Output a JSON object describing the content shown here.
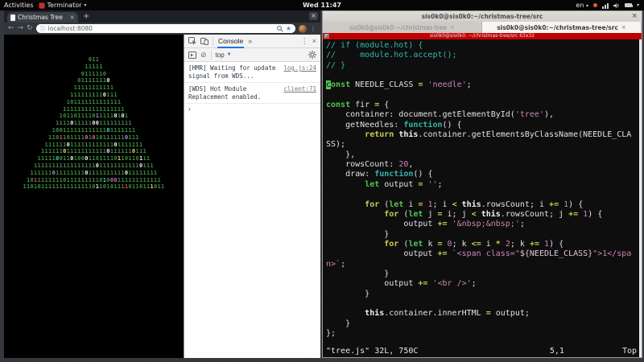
{
  "topbar": {
    "activities": "Activities",
    "app": "Terminator",
    "app_caret": "▾",
    "clock": "Wed 11:47",
    "lang": "en",
    "lang_caret": "▾",
    "system_caret": "▾"
  },
  "browser": {
    "tab_title": "Christmas Tree",
    "tab_close": "×",
    "new_tab": "+",
    "window_close": "×",
    "back": "←",
    "forward": "→",
    "reload": "↻",
    "url_info": "ⓘ",
    "url": "localhost:8080",
    "star": "★",
    "menu": "⋮"
  },
  "devtools": {
    "tab": "Console",
    "more_tabs": "»",
    "menu": "⋮",
    "close": "×",
    "clear_icon": "⊘",
    "frame": "top",
    "frame_caret": "▼",
    "prompt": "›",
    "messages": [
      {
        "text": "[HMR] Waiting for update signal from WDS...",
        "link": "log.js:24"
      },
      {
        "text": "[WDS] Hot Module Replacement enabled.",
        "link": "client:71"
      }
    ]
  },
  "tree": {
    "colors": {
      "g": "#3e8e3e",
      "w": "#e9e9e9",
      "p": "#a98ce0",
      "m": "#d063b6",
      "c": "#43cdc5",
      "r": "#d8524d",
      "y": "#d8d855"
    },
    "rows": [
      {
        "t": "011",
        "m": {}
      },
      {
        "t": "11111",
        "m": {}
      },
      {
        "t": "0111110",
        "m": {}
      },
      {
        "t": "011111110",
        "m": {
          "8": "w"
        }
      },
      {
        "t": "11111111111",
        "m": {}
      },
      {
        "t": "1111111110111",
        "m": {
          "9": "w"
        }
      },
      {
        "t": "101111111111111",
        "m": {}
      },
      {
        "t": "11111111111111111",
        "m": {}
      },
      {
        "t": "1011011110111110101",
        "m": {
          "10": "p",
          "15": "w",
          "17": "w"
        }
      },
      {
        "t": "111101111100111111111",
        "m": {
          "4": "w",
          "10": "w",
          "11": "w"
        }
      },
      {
        "t": "10011111111111101111111",
        "m": {
          "15": "c"
        }
      },
      {
        "t": "1101101111010101111110111",
        "m": {
          "3": "r",
          "10": "m",
          "12": "m",
          "21": "p"
        }
      },
      {
        "t": "111111011111111111101111111",
        "m": {
          "6": "w",
          "19": "w"
        }
      },
      {
        "t": "11111101111111111101111110111",
        "m": {
          "6": "y",
          "18": "w",
          "25": "y"
        }
      },
      {
        "t": "1111100110100011011110110110111",
        "m": {
          "5": "c",
          "9": "w",
          "13": "w",
          "22": "y",
          "28": "w"
        }
      },
      {
        "t": "111111111111111110111111111110111",
        "m": {
          "17": "w",
          "29": "w"
        }
      },
      {
        "t": "11111101111111101111111111011111111",
        "m": {
          "6": "p",
          "15": "w",
          "26": "w"
        }
      },
      {
        "t": "1011111111011111111101000111111111111",
        "m": {
          "2": "r",
          "21": "c",
          "23": "m",
          "24": "m"
        }
      },
      {
        "t": "110101111111111111101101011110110111011",
        "m": {
          "20": "w",
          "28": "r",
          "35": "y"
        }
      }
    ]
  },
  "terminal": {
    "window_title": "sis0k0@sis0k0:~/christmas-tree/src",
    "window_close": "×",
    "tabs": [
      {
        "label": "sis0k0@sis0k0:~/christmas-tree",
        "close": "×",
        "active": false
      },
      {
        "label": "sis0k0@sis0k0:~/christmas-tree/src",
        "close": "×",
        "active": true
      }
    ],
    "red_title": "sis0k0@sis0k0: ~/christmas-tree/src 63x32",
    "status": {
      "file": "\"tree.js\" 32L, 750C",
      "pos": "5,1",
      "scroll": "Top"
    },
    "code": [
      [
        [
          "// if (module.hot) {",
          "c"
        ]
      ],
      [
        [
          "//     module.hot.accept();",
          "c"
        ]
      ],
      [
        [
          "// }",
          "c"
        ]
      ],
      [],
      [
        [
          "c",
          "x"
        ],
        [
          "onst",
          "t"
        ],
        [
          " NEEDLE_CLASS ",
          "p"
        ],
        [
          "=",
          "o"
        ],
        [
          " ",
          "p"
        ],
        [
          "'needle'",
          "s"
        ],
        [
          ";",
          "p"
        ]
      ],
      [],
      [
        [
          "const",
          "t"
        ],
        [
          " fir ",
          "p"
        ],
        [
          "=",
          "o"
        ],
        [
          " {",
          "p"
        ]
      ],
      [
        [
          "    container: document.getElementById(",
          "p"
        ],
        [
          "'tree'",
          "s"
        ],
        [
          "),",
          "p"
        ]
      ],
      [
        [
          "    getNeedles: ",
          "p"
        ],
        [
          "function",
          "i"
        ],
        [
          "() {",
          "p"
        ]
      ],
      [
        [
          "        ",
          "p"
        ],
        [
          "return",
          "k"
        ],
        [
          " ",
          "p"
        ],
        [
          "this",
          "b"
        ],
        [
          ".container.getElementsByClassName(NEEDLE_CLA",
          "p"
        ]
      ],
      [
        [
          "SS);",
          "p"
        ]
      ],
      [
        [
          "    },",
          "p"
        ]
      ],
      [
        [
          "    rowsCount: ",
          "p"
        ],
        [
          "20",
          "n"
        ],
        [
          ",",
          "p"
        ]
      ],
      [
        [
          "    draw: ",
          "p"
        ],
        [
          "function",
          "i"
        ],
        [
          "() {",
          "p"
        ]
      ],
      [
        [
          "        ",
          "p"
        ],
        [
          "let",
          "t"
        ],
        [
          " output ",
          "p"
        ],
        [
          "=",
          "o"
        ],
        [
          " ",
          "p"
        ],
        [
          "''",
          "s"
        ],
        [
          ";",
          "p"
        ]
      ],
      [],
      [
        [
          "        ",
          "p"
        ],
        [
          "for",
          "k"
        ],
        [
          " (",
          "p"
        ],
        [
          "let",
          "t"
        ],
        [
          " i ",
          "p"
        ],
        [
          "=",
          "o"
        ],
        [
          " ",
          "p"
        ],
        [
          "1",
          "n"
        ],
        [
          "; i ",
          "p"
        ],
        [
          "<",
          "o"
        ],
        [
          " ",
          "p"
        ],
        [
          "this",
          "b"
        ],
        [
          ".rowsCount; i ",
          "p"
        ],
        [
          "+=",
          "o"
        ],
        [
          " ",
          "p"
        ],
        [
          "1",
          "n"
        ],
        [
          ") {",
          "p"
        ]
      ],
      [
        [
          "            ",
          "p"
        ],
        [
          "for",
          "k"
        ],
        [
          " (",
          "p"
        ],
        [
          "let",
          "t"
        ],
        [
          " j ",
          "p"
        ],
        [
          "=",
          "o"
        ],
        [
          " i; j ",
          "p"
        ],
        [
          "<",
          "o"
        ],
        [
          " ",
          "p"
        ],
        [
          "this",
          "b"
        ],
        [
          ".rowsCount; j ",
          "p"
        ],
        [
          "+=",
          "o"
        ],
        [
          " ",
          "p"
        ],
        [
          "1",
          "n"
        ],
        [
          ") {",
          "p"
        ]
      ],
      [
        [
          "                output ",
          "p"
        ],
        [
          "+=",
          "o"
        ],
        [
          " ",
          "p"
        ],
        [
          "'&nbsp;&nbsp;'",
          "s"
        ],
        [
          ";",
          "p"
        ]
      ],
      [
        [
          "            }",
          "p"
        ]
      ],
      [
        [
          "            ",
          "p"
        ],
        [
          "for",
          "k"
        ],
        [
          " (",
          "p"
        ],
        [
          "let",
          "t"
        ],
        [
          " k ",
          "p"
        ],
        [
          "=",
          "o"
        ],
        [
          " ",
          "p"
        ],
        [
          "0",
          "n"
        ],
        [
          "; k ",
          "p"
        ],
        [
          "<=",
          "o"
        ],
        [
          " i ",
          "p"
        ],
        [
          "*",
          "o"
        ],
        [
          " ",
          "p"
        ],
        [
          "2",
          "n"
        ],
        [
          "; k ",
          "p"
        ],
        [
          "+=",
          "o"
        ],
        [
          " ",
          "p"
        ],
        [
          "1",
          "n"
        ],
        [
          ") {",
          "p"
        ]
      ],
      [
        [
          "                output ",
          "p"
        ],
        [
          "+=",
          "o"
        ],
        [
          " ",
          "p"
        ],
        [
          "`<span class=\"",
          "s"
        ],
        [
          "${NEEDLE_CLASS}",
          "vsp"
        ],
        [
          "\">1</spa",
          "s"
        ]
      ],
      [
        [
          "n>`",
          "s"
        ],
        [
          ";",
          "p"
        ]
      ],
      [
        [
          "            }",
          "p"
        ]
      ],
      [
        [
          "            output ",
          "p"
        ],
        [
          "+=",
          "o"
        ],
        [
          " ",
          "p"
        ],
        [
          "'<br />'",
          "s"
        ],
        [
          ";",
          "p"
        ]
      ],
      [
        [
          "        }",
          "p"
        ]
      ],
      [],
      [
        [
          "        ",
          "p"
        ],
        [
          "this",
          "b"
        ],
        [
          ".container.innerHTML ",
          "p"
        ],
        [
          "=",
          "o"
        ],
        [
          " output;",
          "p"
        ]
      ],
      [
        [
          "    }",
          "p"
        ]
      ],
      [
        [
          "};",
          "p"
        ]
      ],
      []
    ]
  }
}
